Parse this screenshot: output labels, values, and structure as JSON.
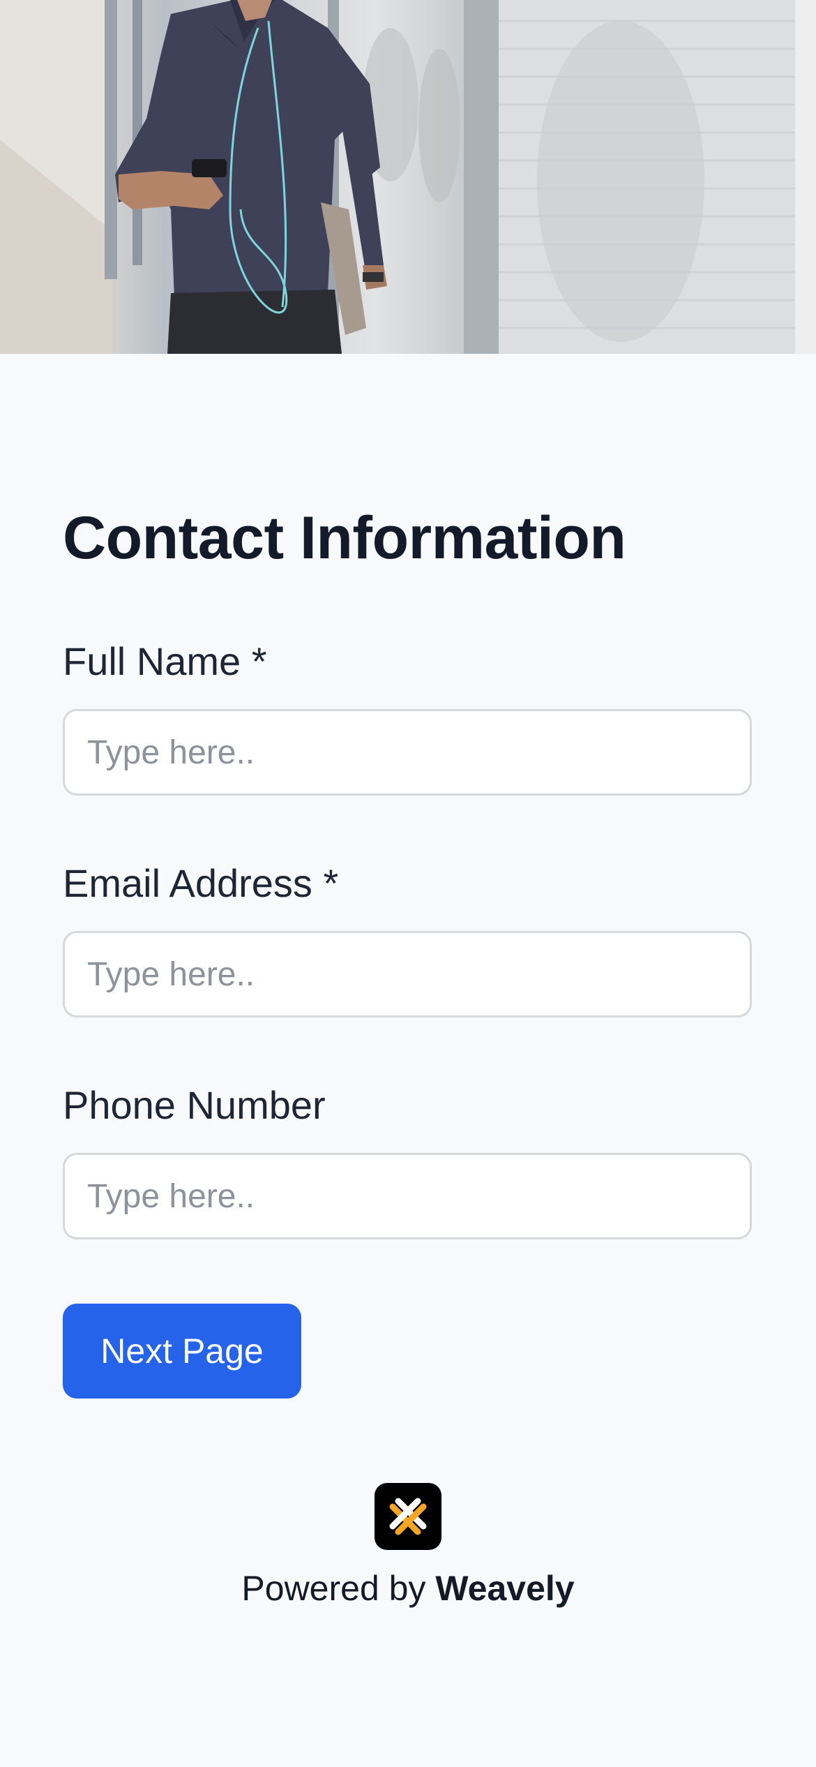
{
  "form": {
    "title": "Contact Information",
    "fields": [
      {
        "label": "Full Name *",
        "placeholder": "Type here..",
        "value": ""
      },
      {
        "label": "Email Address *",
        "placeholder": "Type here..",
        "value": ""
      },
      {
        "label": "Phone Number",
        "placeholder": "Type here..",
        "value": ""
      }
    ],
    "next_label": "Next Page"
  },
  "footer": {
    "powered_prefix": "Powered by",
    "brand": "Weavely",
    "logo_icon": "weavely-logo-icon"
  },
  "colors": {
    "accent": "#2563eb",
    "background": "#f8f9fb",
    "logo_bg": "#000000",
    "logo_accent": "#f5a623"
  }
}
